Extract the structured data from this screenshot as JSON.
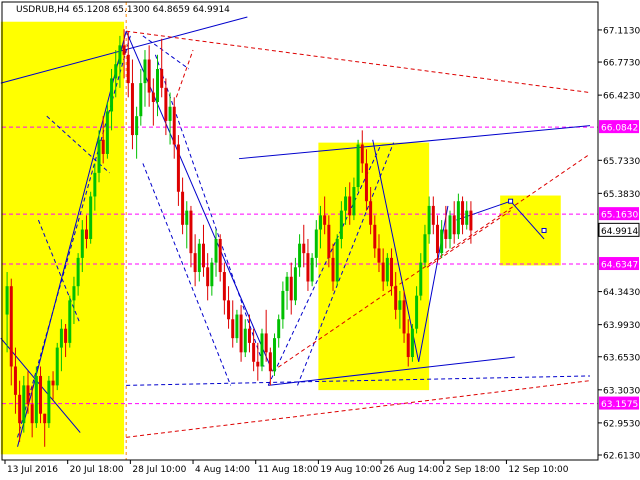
{
  "chart_data": {
    "type": "candlestick",
    "title": "USDRUB,H4  65.1208 65.1300 64.8659 64.9914",
    "symbol": "USDRUB",
    "timeframe": "H4",
    "ohlc_header": {
      "open": 65.1208,
      "high": 65.13,
      "low": 64.8659,
      "close": 64.9914
    },
    "ylim": [
      62.613,
      67.25
    ],
    "y_ticks": [
      "67.1130",
      "66.7730",
      "66.4230",
      "66.0842",
      "65.7330",
      "65.3830",
      "65.1630",
      "64.9914",
      "64.6347",
      "64.3430",
      "63.9930",
      "63.6530",
      "63.3030",
      "63.1575",
      "62.9530",
      "62.6130"
    ],
    "highlighted_levels": [
      {
        "value": 66.0842,
        "label": "66.0842",
        "color": "#ff00ff"
      },
      {
        "value": 65.163,
        "label": "65.1630",
        "color": "#ff00ff"
      },
      {
        "value": 64.6347,
        "label": "64.6347",
        "color": "#ff00ff"
      },
      {
        "value": 63.1575,
        "label": "63.1575",
        "color": "#ff00ff"
      }
    ],
    "current_price": {
      "value": 64.9914,
      "label": "64.9914"
    },
    "x_ticks": [
      "13 Jul 2016",
      "20 Jul 18:00",
      "28 Jul 10:00",
      "4 Aug 14:00",
      "11 Aug 18:00",
      "19 Aug 10:00",
      "26 Aug 14:00",
      "2 Sep 18:00",
      "12 Sep 10:00"
    ],
    "x_range": [
      0,
      140
    ],
    "x_tick_index": [
      0,
      15,
      30,
      45,
      60,
      75,
      90,
      105,
      120
    ],
    "candles": [
      [
        64.1,
        64.55,
        63.7,
        64.4
      ],
      [
        64.4,
        64.48,
        63.35,
        63.55
      ],
      [
        63.55,
        63.75,
        63.05,
        63.25
      ],
      [
        63.25,
        63.4,
        62.75,
        62.95
      ],
      [
        62.95,
        63.45,
        62.85,
        63.35
      ],
      [
        63.35,
        63.5,
        63.05,
        63.15
      ],
      [
        63.15,
        63.35,
        62.8,
        62.95
      ],
      [
        62.95,
        63.55,
        62.9,
        63.45
      ],
      [
        63.45,
        63.55,
        62.95,
        63.05
      ],
      [
        63.05,
        63.05,
        62.7,
        62.95
      ],
      [
        62.95,
        63.45,
        62.9,
        63.4
      ],
      [
        63.4,
        63.5,
        63.2,
        63.35
      ],
      [
        63.35,
        63.8,
        63.3,
        63.75
      ],
      [
        63.75,
        64.05,
        63.5,
        63.95
      ],
      [
        63.95,
        64.0,
        63.65,
        63.8
      ],
      [
        63.8,
        64.3,
        63.75,
        64.25
      ],
      [
        64.25,
        64.5,
        64.0,
        64.4
      ],
      [
        64.4,
        64.75,
        64.3,
        64.7
      ],
      [
        64.7,
        65.1,
        64.55,
        65.0
      ],
      [
        65.0,
        65.15,
        64.8,
        64.9
      ],
      [
        64.9,
        65.4,
        64.85,
        65.35
      ],
      [
        65.35,
        65.7,
        65.2,
        65.6
      ],
      [
        65.6,
        66.05,
        65.5,
        65.95
      ],
      [
        65.95,
        66.2,
        65.7,
        65.8
      ],
      [
        65.8,
        66.35,
        65.75,
        66.25
      ],
      [
        66.25,
        66.7,
        66.05,
        66.6
      ],
      [
        66.6,
        66.9,
        66.4,
        66.75
      ],
      [
        66.75,
        67.05,
        66.5,
        66.95
      ],
      [
        66.95,
        67.12,
        66.6,
        66.85
      ],
      [
        66.85,
        67.1,
        66.4,
        66.55
      ],
      [
        66.55,
        66.8,
        65.85,
        66.0
      ],
      [
        66.0,
        66.3,
        65.75,
        66.2
      ],
      [
        66.2,
        66.7,
        66.1,
        66.55
      ],
      [
        66.55,
        66.9,
        66.3,
        66.8
      ],
      [
        66.8,
        66.95,
        66.3,
        66.45
      ],
      [
        66.45,
        66.6,
        66.1,
        66.35
      ],
      [
        66.35,
        66.85,
        66.2,
        66.7
      ],
      [
        66.7,
        67.02,
        66.4,
        66.5
      ],
      [
        66.5,
        66.6,
        66.0,
        66.15
      ],
      [
        66.15,
        66.45,
        65.9,
        66.3
      ],
      [
        66.3,
        66.4,
        65.75,
        65.9
      ],
      [
        65.9,
        66.0,
        65.25,
        65.4
      ],
      [
        65.4,
        65.55,
        64.95,
        65.05
      ],
      [
        65.05,
        65.3,
        64.8,
        65.2
      ],
      [
        65.2,
        65.25,
        64.6,
        64.75
      ],
      [
        64.75,
        64.95,
        64.4,
        64.55
      ],
      [
        64.55,
        64.9,
        64.45,
        64.85
      ],
      [
        64.85,
        65.05,
        64.5,
        64.6
      ],
      [
        64.6,
        64.75,
        64.25,
        64.4
      ],
      [
        64.4,
        64.7,
        64.3,
        64.65
      ],
      [
        64.65,
        65.0,
        64.5,
        64.9
      ],
      [
        64.9,
        64.95,
        64.45,
        64.55
      ],
      [
        64.55,
        64.65,
        64.1,
        64.25
      ],
      [
        64.25,
        64.4,
        63.95,
        64.05
      ],
      [
        64.05,
        64.25,
        63.75,
        63.85
      ],
      [
        63.85,
        64.15,
        63.8,
        64.1
      ],
      [
        64.1,
        64.2,
        63.6,
        63.7
      ],
      [
        63.7,
        64.05,
        63.65,
        63.95
      ],
      [
        63.95,
        64.1,
        63.7,
        63.8
      ],
      [
        63.8,
        63.95,
        63.5,
        63.6
      ],
      [
        63.6,
        63.8,
        63.4,
        63.55
      ],
      [
        63.55,
        63.95,
        63.5,
        63.9
      ],
      [
        63.9,
        64.15,
        63.6,
        63.7
      ],
      [
        63.7,
        63.75,
        63.35,
        63.5
      ],
      [
        63.5,
        63.9,
        63.45,
        63.85
      ],
      [
        63.85,
        64.1,
        63.75,
        64.05
      ],
      [
        64.05,
        64.45,
        63.95,
        64.35
      ],
      [
        64.35,
        64.55,
        64.15,
        64.5
      ],
      [
        64.5,
        64.65,
        64.1,
        64.25
      ],
      [
        64.25,
        64.7,
        64.2,
        64.6
      ],
      [
        64.6,
        64.95,
        64.5,
        64.85
      ],
      [
        64.85,
        65.05,
        64.6,
        64.75
      ],
      [
        64.75,
        64.9,
        64.35,
        64.45
      ],
      [
        64.45,
        64.75,
        64.4,
        64.7
      ],
      [
        64.7,
        65.1,
        64.6,
        65.0
      ],
      [
        65.0,
        65.25,
        64.8,
        65.15
      ],
      [
        65.15,
        65.35,
        64.95,
        65.05
      ],
      [
        65.05,
        65.15,
        64.6,
        64.7
      ],
      [
        64.7,
        64.85,
        64.35,
        64.45
      ],
      [
        64.45,
        64.95,
        64.4,
        64.9
      ],
      [
        64.9,
        65.3,
        64.8,
        65.2
      ],
      [
        65.2,
        65.45,
        65.05,
        65.35
      ],
      [
        65.35,
        65.5,
        65.05,
        65.15
      ],
      [
        65.15,
        65.55,
        65.1,
        65.45
      ],
      [
        65.45,
        65.95,
        65.4,
        65.9
      ],
      [
        65.9,
        66.05,
        65.6,
        65.7
      ],
      [
        65.7,
        65.85,
        65.2,
        65.3
      ],
      [
        65.3,
        65.45,
        64.95,
        65.05
      ],
      [
        65.05,
        65.15,
        64.7,
        64.8
      ],
      [
        64.8,
        64.95,
        64.55,
        64.65
      ],
      [
        64.65,
        64.8,
        64.35,
        64.45
      ],
      [
        64.45,
        64.75,
        64.4,
        64.7
      ],
      [
        64.7,
        64.8,
        64.3,
        64.4
      ],
      [
        64.4,
        64.55,
        64.05,
        64.15
      ],
      [
        64.15,
        64.35,
        63.95,
        64.25
      ],
      [
        64.25,
        64.35,
        63.8,
        63.9
      ],
      [
        63.9,
        64.05,
        63.55,
        63.65
      ],
      [
        63.65,
        64.0,
        63.6,
        63.95
      ],
      [
        63.95,
        64.4,
        63.9,
        64.3
      ],
      [
        64.3,
        64.75,
        64.25,
        64.65
      ],
      [
        64.65,
        65.05,
        64.6,
        64.95
      ],
      [
        64.95,
        65.35,
        64.85,
        65.25
      ],
      [
        65.25,
        65.35,
        64.95,
        65.05
      ],
      [
        65.05,
        65.15,
        64.65,
        64.75
      ],
      [
        64.75,
        65.1,
        64.7,
        65.0
      ],
      [
        65.0,
        65.25,
        64.8,
        64.9
      ],
      [
        64.9,
        65.2,
        64.8,
        65.15
      ],
      [
        65.15,
        65.3,
        64.85,
        64.95
      ],
      [
        64.95,
        65.38,
        64.9,
        65.3
      ],
      [
        65.3,
        65.35,
        64.95,
        65.05
      ],
      [
        65.05,
        65.3,
        65.0,
        65.2
      ],
      [
        65.2,
        65.3,
        64.85,
        64.99
      ]
    ]
  }
}
